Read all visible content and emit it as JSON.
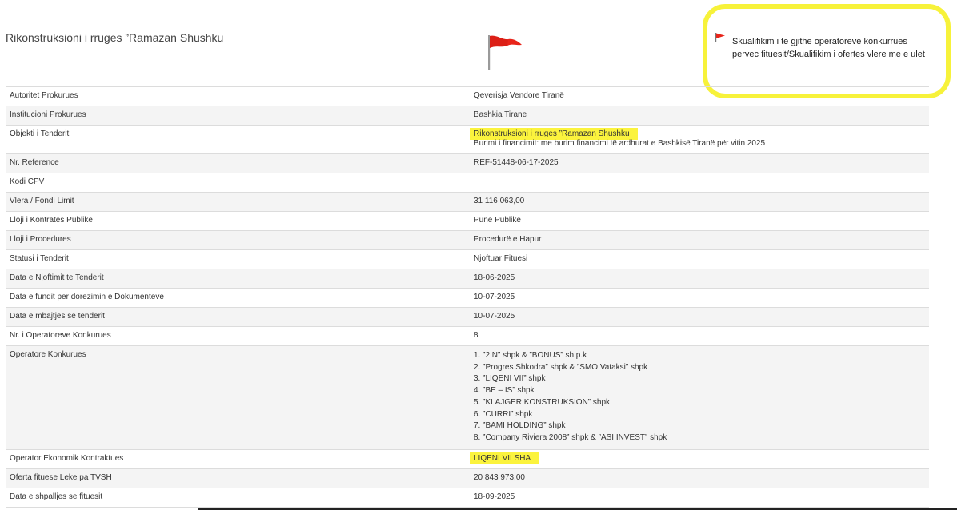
{
  "page": {
    "title": "Rikonstruksioni i rruges ”Ramazan Shushku",
    "note": "Skualifikim i te gjithe operatoreve konkurrues pervec fituesit/Skualifikim i ofertes vlere me e ulet",
    "flag_icon": "red-flag-icon",
    "highlight_color": "#fbf33d"
  },
  "details": {
    "autoriteti": {
      "label": "Autoritet Prokurues",
      "value": "Qeverisja Vendore Tiranë"
    },
    "institucioni": {
      "label": "Institucioni Prokurues",
      "value": "Bashkia Tirane"
    },
    "objekti": {
      "label": "Objekti i Tenderit",
      "value": "Rikonstruksioni i rruges ”Ramazan Shushku",
      "subvalue": "Burimi i financimit: me burim financimi të ardhurat e Bashkisë Tiranë për vitin 2025"
    },
    "reference": {
      "label": "Nr. Reference",
      "value": "REF-51448-06-17-2025"
    },
    "cpv": {
      "label": "Kodi CPV",
      "value": ""
    },
    "vlera": {
      "label": "Vlera / Fondi Limit",
      "value": "31 116 063,00"
    },
    "lloji_kontrates": {
      "label": "Lloji i Kontrates Publike",
      "value": "Punë Publike"
    },
    "lloji_procedures": {
      "label": "Lloji i Procedures",
      "value": "Procedurë e Hapur"
    },
    "statusi": {
      "label": "Statusi i Tenderit",
      "value": "Njoftuar Fituesi"
    },
    "data_njoftimit": {
      "label": "Data e Njoftimit te Tenderit",
      "value": "18-06-2025"
    },
    "data_fundit": {
      "label": "Data e fundit per dorezimin e Dokumenteve",
      "value": "10-07-2025"
    },
    "data_mbajtjes": {
      "label": "Data e mbajtjes se tenderit",
      "value": "10-07-2025"
    },
    "nr_operatoreve": {
      "label": "Nr. i Operatoreve Konkurues",
      "value": "8"
    },
    "operatore": {
      "label": "Operatore Konkurues",
      "items": [
        "1. ”2 N” shpk & ”BONUS” sh.p.k",
        "2. ”Progres Shkodra” shpk & ”SMO Vataksi” shpk",
        "3. ”LIQENI VII” shpk",
        "4. ”BE – IS” shpk",
        "5. ”KLAJGER KONSTRUKSION” shpk",
        "6. ”CURRI” shpk",
        "7. ”BAMI HOLDING” shpk",
        "8. ”Company Riviera 2008” shpk & ”ASI INVEST” shpk"
      ]
    },
    "kontraktues": {
      "label": "Operator Ekonomik Kontraktues",
      "value": "LIQENI VII SHA"
    },
    "oferta": {
      "label": "Oferta fituese Leke pa TVSH",
      "value": "20 843 973,00"
    },
    "data_shpalljes": {
      "label": "Data e shpalljes se fituesit",
      "value": "18-09-2025"
    }
  }
}
